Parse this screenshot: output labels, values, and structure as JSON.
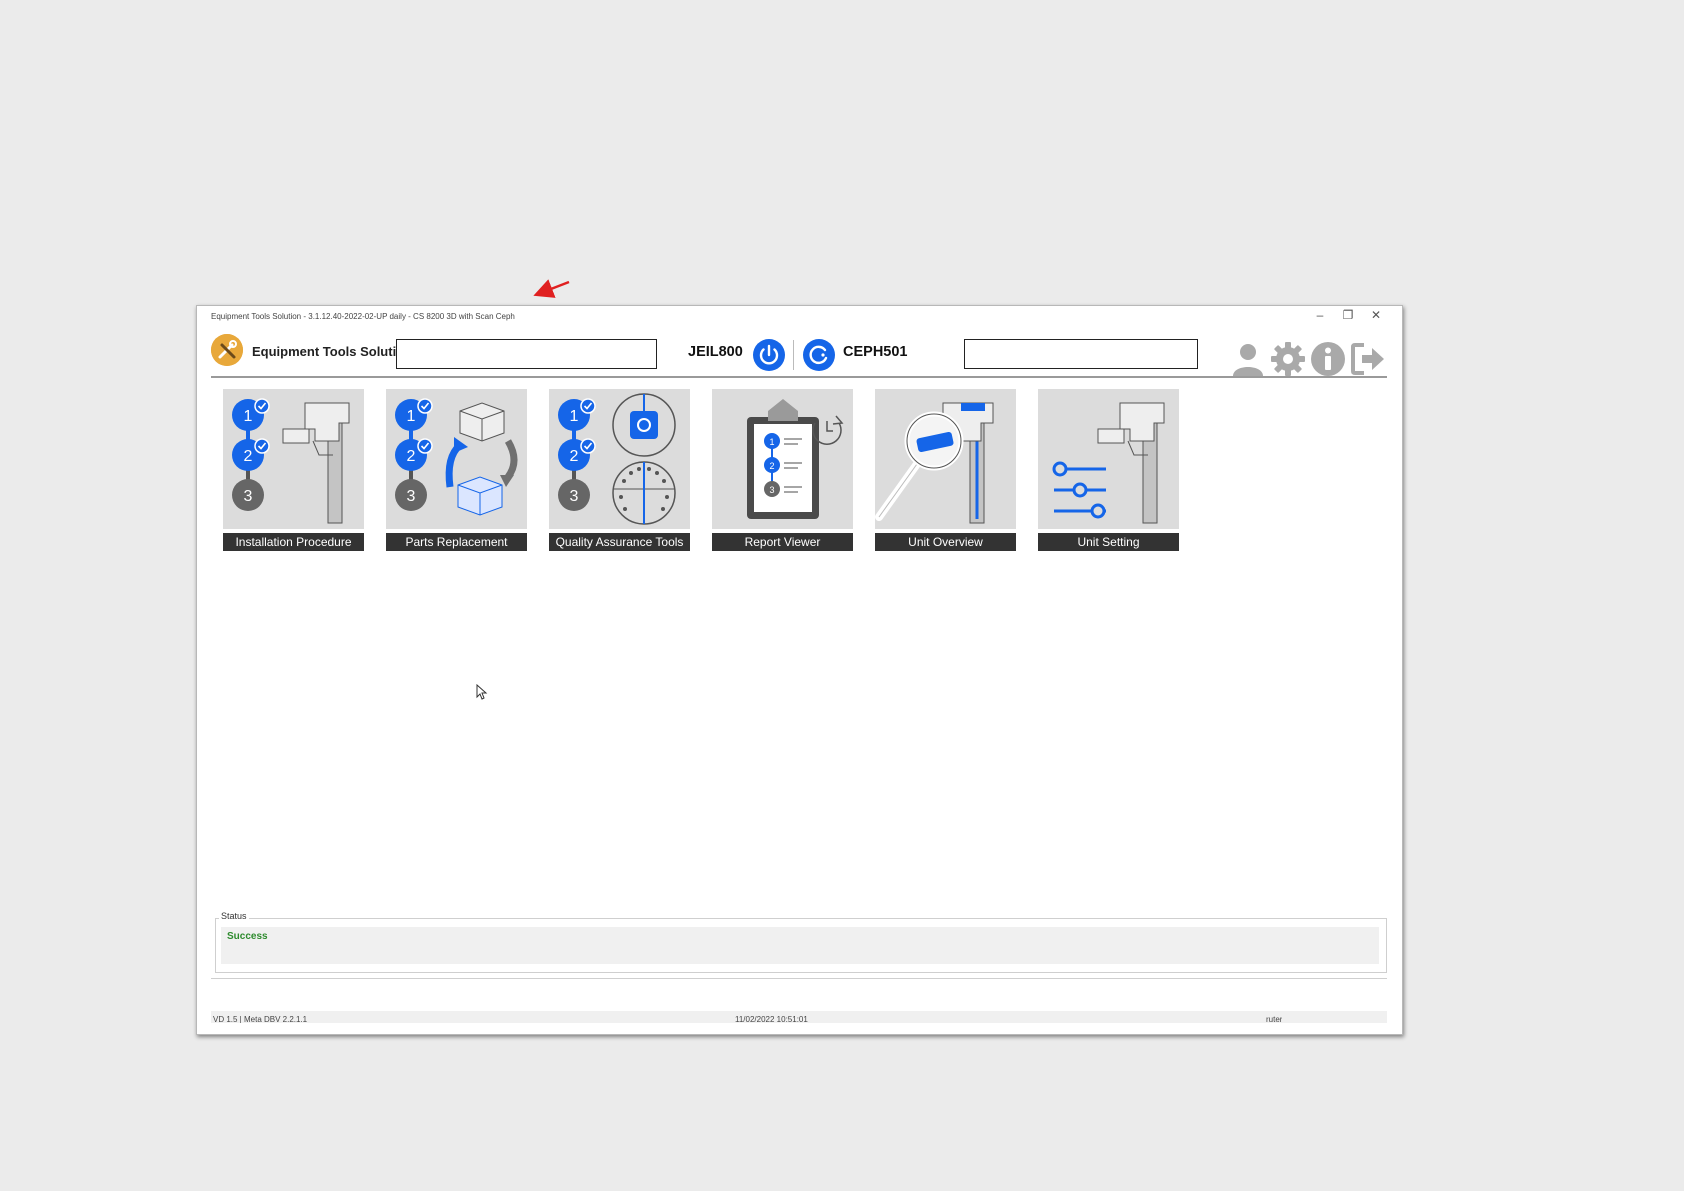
{
  "window": {
    "title": "Equipment Tools Solution - 3.1.12.40-2022-02-UP daily - CS 8200 3D with Scan Ceph",
    "minimize_glyph": "–",
    "maximize_glyph": "❐",
    "close_glyph": "✕"
  },
  "header": {
    "app_name": "Equipment Tools Solution",
    "device_primary": "JEIL800",
    "device_secondary": "CEPH501",
    "icons": [
      "user-icon",
      "gear-icon",
      "info-icon",
      "logout-icon"
    ]
  },
  "tiles": [
    {
      "label": "Installation Procedure",
      "icon": "installation-procedure-icon"
    },
    {
      "label": "Parts Replacement",
      "icon": "parts-replacement-icon"
    },
    {
      "label": "Quality Assurance Tools",
      "icon": "quality-assurance-icon"
    },
    {
      "label": "Report Viewer",
      "icon": "report-viewer-icon"
    },
    {
      "label": "Unit Overview",
      "icon": "unit-overview-icon"
    },
    {
      "label": "Unit Setting",
      "icon": "unit-setting-icon"
    }
  ],
  "steps": [
    "1",
    "2",
    "3"
  ],
  "status": {
    "group_label": "Status",
    "message": "Success"
  },
  "statusbar": {
    "left": "VD 1.5 | Meta DBV 2.2.1.1",
    "center": "11/02/2022 10:51:01",
    "right": "ruter"
  },
  "colors": {
    "accent_blue": "#1565e8",
    "annotation_red": "#e02020",
    "success_green": "#2e8b2e",
    "icon_gray": "#a9a9a9",
    "tile_bg": "#dcdcdc",
    "label_bg": "#333333"
  }
}
